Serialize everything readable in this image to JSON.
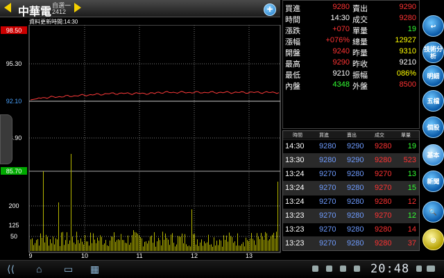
{
  "header": {
    "stock_name": "中華電",
    "group": "自選一",
    "code": "2412",
    "update_text": "資料更新時間:14:30"
  },
  "chart": {
    "price_labels": [
      "95.30",
      "92.10",
      "88.90"
    ],
    "price_top": "98.50",
    "price_bottom": "85.70",
    "volume_labels": [
      "200",
      "125",
      "50"
    ],
    "time_labels": [
      "9",
      "10",
      "11",
      "12",
      "13"
    ],
    "colors": {
      "price_line": "#ff3a3a",
      "volume": "#b8b800",
      "top_box": "#cc0000",
      "bottom_box": "#00aa00",
      "ref_label": "#4aa3ff"
    }
  },
  "quote": {
    "rows": [
      {
        "l1": "買進",
        "v1": "9280",
        "c1": "red",
        "l2": "賣出",
        "v2": "9290",
        "c2": "red"
      },
      {
        "l1": "時間",
        "v1": "14:30",
        "c1": "white",
        "l2": "成交",
        "v2": "9280",
        "c2": "red"
      },
      {
        "l1": "漲跌",
        "v1": "+070",
        "c1": "red",
        "l2": "單量",
        "v2": "19",
        "c2": "green"
      },
      {
        "l1": "漲幅",
        "v1": "+076%",
        "c1": "red",
        "l2": "總量",
        "v2": "12927",
        "c2": "yellow"
      },
      {
        "l1": "開盤",
        "v1": "9240",
        "c1": "red",
        "l2": "昨量",
        "v2": "9310",
        "c2": "yellow"
      },
      {
        "l1": "最高",
        "v1": "9290",
        "c1": "red",
        "l2": "昨收",
        "v2": "9210",
        "c2": "white"
      },
      {
        "l1": "最低",
        "v1": "9210",
        "c1": "white",
        "l2": "振幅",
        "v2": "086%",
        "c2": "yellow"
      },
      {
        "l1": "內盤",
        "v1": "4348",
        "c1": "green",
        "l2": "外盤",
        "v2": "8500",
        "c2": "red"
      }
    ]
  },
  "trades": {
    "headers": [
      "時間",
      "買進",
      "賣出",
      "成交",
      "單量"
    ],
    "rows": [
      {
        "time": "14:30",
        "bid": "9280",
        "ask": "9290",
        "deal": "9280",
        "vol": "19",
        "vc": "green"
      },
      {
        "time": "13:30",
        "bid": "9280",
        "ask": "9290",
        "deal": "9280",
        "vol": "523",
        "vc": "red"
      },
      {
        "time": "13:24",
        "bid": "9270",
        "ask": "9280",
        "deal": "9270",
        "vol": "13",
        "vc": "green"
      },
      {
        "time": "13:24",
        "bid": "9270",
        "ask": "9280",
        "deal": "9270",
        "vol": "15",
        "vc": "green"
      },
      {
        "time": "13:24",
        "bid": "9270",
        "ask": "9280",
        "deal": "9280",
        "vol": "12",
        "vc": "red"
      },
      {
        "time": "13:23",
        "bid": "9270",
        "ask": "9280",
        "deal": "9270",
        "vol": "12",
        "vc": "green"
      },
      {
        "time": "13:23",
        "bid": "9270",
        "ask": "9280",
        "deal": "9280",
        "vol": "14",
        "vc": "red"
      },
      {
        "time": "13:23",
        "bid": "9270",
        "ask": "9280",
        "deal": "9280",
        "vol": "37",
        "vc": "red"
      }
    ]
  },
  "sidebar": {
    "buttons": [
      {
        "label": "↩",
        "name": "back-button"
      },
      {
        "label": "技術分析",
        "name": "technical-analysis-button"
      },
      {
        "label": "明細",
        "name": "details-button"
      },
      {
        "label": "五檔",
        "name": "five-levels-button"
      },
      {
        "label": "個股",
        "name": "individual-stock-button"
      },
      {
        "label": "基本",
        "name": "basic-button"
      },
      {
        "label": "新聞",
        "name": "news-button"
      },
      {
        "label": "🔍",
        "name": "search-button"
      },
      {
        "label": "◎",
        "name": "target-button"
      }
    ]
  },
  "system": {
    "clock": "20:48"
  }
}
